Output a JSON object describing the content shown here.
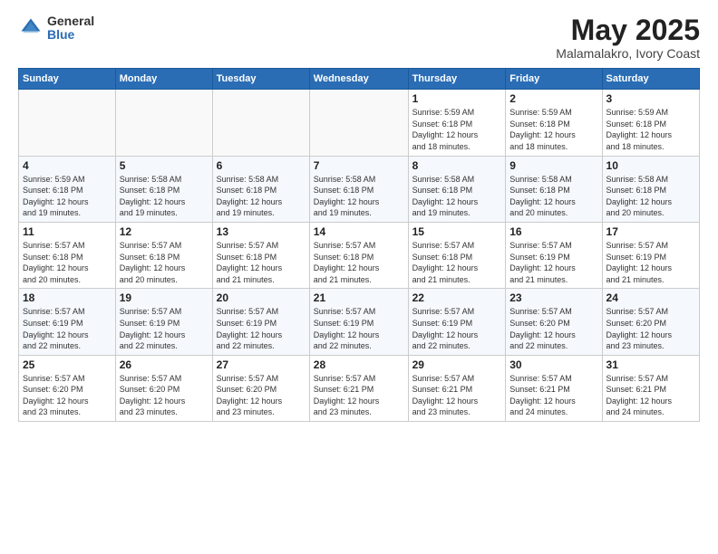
{
  "header": {
    "logo_general": "General",
    "logo_blue": "Blue",
    "title": "May 2025",
    "subtitle": "Malamalakro, Ivory Coast"
  },
  "days_of_week": [
    "Sunday",
    "Monday",
    "Tuesday",
    "Wednesday",
    "Thursday",
    "Friday",
    "Saturday"
  ],
  "weeks": [
    {
      "days": [
        {
          "num": "",
          "info": ""
        },
        {
          "num": "",
          "info": ""
        },
        {
          "num": "",
          "info": ""
        },
        {
          "num": "",
          "info": ""
        },
        {
          "num": "1",
          "info": "Sunrise: 5:59 AM\nSunset: 6:18 PM\nDaylight: 12 hours\nand 18 minutes."
        },
        {
          "num": "2",
          "info": "Sunrise: 5:59 AM\nSunset: 6:18 PM\nDaylight: 12 hours\nand 18 minutes."
        },
        {
          "num": "3",
          "info": "Sunrise: 5:59 AM\nSunset: 6:18 PM\nDaylight: 12 hours\nand 18 minutes."
        }
      ]
    },
    {
      "days": [
        {
          "num": "4",
          "info": "Sunrise: 5:59 AM\nSunset: 6:18 PM\nDaylight: 12 hours\nand 19 minutes."
        },
        {
          "num": "5",
          "info": "Sunrise: 5:58 AM\nSunset: 6:18 PM\nDaylight: 12 hours\nand 19 minutes."
        },
        {
          "num": "6",
          "info": "Sunrise: 5:58 AM\nSunset: 6:18 PM\nDaylight: 12 hours\nand 19 minutes."
        },
        {
          "num": "7",
          "info": "Sunrise: 5:58 AM\nSunset: 6:18 PM\nDaylight: 12 hours\nand 19 minutes."
        },
        {
          "num": "8",
          "info": "Sunrise: 5:58 AM\nSunset: 6:18 PM\nDaylight: 12 hours\nand 19 minutes."
        },
        {
          "num": "9",
          "info": "Sunrise: 5:58 AM\nSunset: 6:18 PM\nDaylight: 12 hours\nand 20 minutes."
        },
        {
          "num": "10",
          "info": "Sunrise: 5:58 AM\nSunset: 6:18 PM\nDaylight: 12 hours\nand 20 minutes."
        }
      ]
    },
    {
      "days": [
        {
          "num": "11",
          "info": "Sunrise: 5:57 AM\nSunset: 6:18 PM\nDaylight: 12 hours\nand 20 minutes."
        },
        {
          "num": "12",
          "info": "Sunrise: 5:57 AM\nSunset: 6:18 PM\nDaylight: 12 hours\nand 20 minutes."
        },
        {
          "num": "13",
          "info": "Sunrise: 5:57 AM\nSunset: 6:18 PM\nDaylight: 12 hours\nand 21 minutes."
        },
        {
          "num": "14",
          "info": "Sunrise: 5:57 AM\nSunset: 6:18 PM\nDaylight: 12 hours\nand 21 minutes."
        },
        {
          "num": "15",
          "info": "Sunrise: 5:57 AM\nSunset: 6:18 PM\nDaylight: 12 hours\nand 21 minutes."
        },
        {
          "num": "16",
          "info": "Sunrise: 5:57 AM\nSunset: 6:19 PM\nDaylight: 12 hours\nand 21 minutes."
        },
        {
          "num": "17",
          "info": "Sunrise: 5:57 AM\nSunset: 6:19 PM\nDaylight: 12 hours\nand 21 minutes."
        }
      ]
    },
    {
      "days": [
        {
          "num": "18",
          "info": "Sunrise: 5:57 AM\nSunset: 6:19 PM\nDaylight: 12 hours\nand 22 minutes."
        },
        {
          "num": "19",
          "info": "Sunrise: 5:57 AM\nSunset: 6:19 PM\nDaylight: 12 hours\nand 22 minutes."
        },
        {
          "num": "20",
          "info": "Sunrise: 5:57 AM\nSunset: 6:19 PM\nDaylight: 12 hours\nand 22 minutes."
        },
        {
          "num": "21",
          "info": "Sunrise: 5:57 AM\nSunset: 6:19 PM\nDaylight: 12 hours\nand 22 minutes."
        },
        {
          "num": "22",
          "info": "Sunrise: 5:57 AM\nSunset: 6:19 PM\nDaylight: 12 hours\nand 22 minutes."
        },
        {
          "num": "23",
          "info": "Sunrise: 5:57 AM\nSunset: 6:20 PM\nDaylight: 12 hours\nand 22 minutes."
        },
        {
          "num": "24",
          "info": "Sunrise: 5:57 AM\nSunset: 6:20 PM\nDaylight: 12 hours\nand 23 minutes."
        }
      ]
    },
    {
      "days": [
        {
          "num": "25",
          "info": "Sunrise: 5:57 AM\nSunset: 6:20 PM\nDaylight: 12 hours\nand 23 minutes."
        },
        {
          "num": "26",
          "info": "Sunrise: 5:57 AM\nSunset: 6:20 PM\nDaylight: 12 hours\nand 23 minutes."
        },
        {
          "num": "27",
          "info": "Sunrise: 5:57 AM\nSunset: 6:20 PM\nDaylight: 12 hours\nand 23 minutes."
        },
        {
          "num": "28",
          "info": "Sunrise: 5:57 AM\nSunset: 6:21 PM\nDaylight: 12 hours\nand 23 minutes."
        },
        {
          "num": "29",
          "info": "Sunrise: 5:57 AM\nSunset: 6:21 PM\nDaylight: 12 hours\nand 23 minutes."
        },
        {
          "num": "30",
          "info": "Sunrise: 5:57 AM\nSunset: 6:21 PM\nDaylight: 12 hours\nand 24 minutes."
        },
        {
          "num": "31",
          "info": "Sunrise: 5:57 AM\nSunset: 6:21 PM\nDaylight: 12 hours\nand 24 minutes."
        }
      ]
    }
  ]
}
